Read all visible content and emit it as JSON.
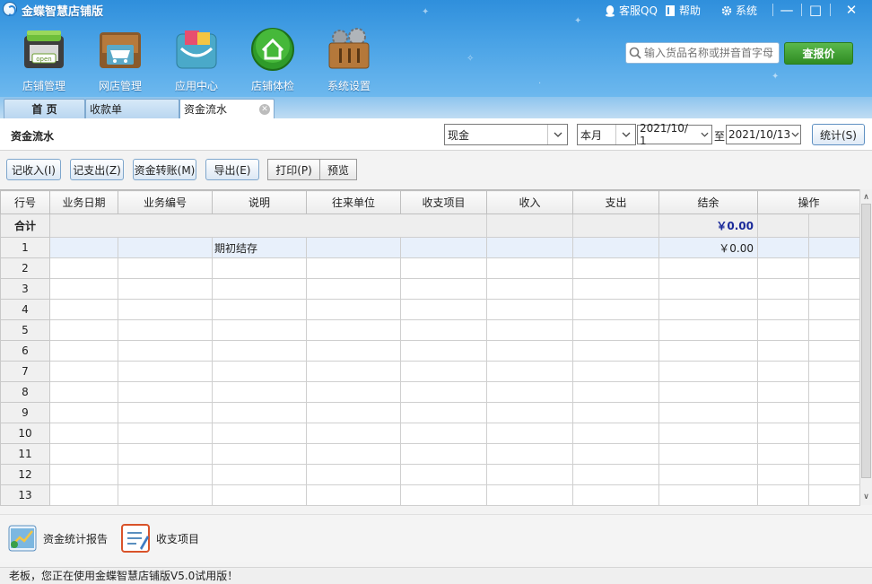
{
  "app": {
    "title": "金蝶智慧店铺版"
  },
  "top_menu": {
    "qq": "客服QQ",
    "help": "帮助",
    "system": "系统"
  },
  "window_controls": {
    "minimize": "—",
    "maximize": "□",
    "close": "✕"
  },
  "nav": [
    {
      "label": "店铺管理",
      "icon": "store-icon"
    },
    {
      "label": "网店管理",
      "icon": "online-shop-cart-icon"
    },
    {
      "label": "应用中心",
      "icon": "app-center-icon"
    },
    {
      "label": "店铺体检",
      "icon": "home-check-icon"
    },
    {
      "label": "系统设置",
      "icon": "settings-toolbox-icon"
    }
  ],
  "search": {
    "placeholder": "输入货品名称或拼音首字母",
    "button": "查报价"
  },
  "tabs": [
    {
      "label": "首 页"
    },
    {
      "label": "收款单"
    },
    {
      "label": "资金流水",
      "active": true
    }
  ],
  "panel": {
    "title": "资金流水",
    "account": "现金",
    "period": "本月",
    "date_from": "2021/10/ 1",
    "to_label": "至",
    "date_to": "2021/10/13",
    "stat_button": "统计(S)"
  },
  "toolbar": {
    "record_income": "记收入(I)",
    "record_expense": "记支出(Z)",
    "transfer": "资金转账(M)",
    "export": "导出(E)",
    "print": "打印(P)",
    "preview": "预览"
  },
  "table": {
    "columns": [
      "行号",
      "业务日期",
      "业务编号",
      "说明",
      "往来单位",
      "收支项目",
      "收入",
      "支出",
      "结余",
      "操作"
    ],
    "total_row": {
      "label": "合计",
      "balance": "￥0.00"
    },
    "rows": [
      {
        "no": "1",
        "date": "",
        "code": "",
        "desc": "期初结存",
        "partner": "",
        "item": "",
        "income": "",
        "expense": "",
        "balance": "￥0.00"
      },
      {
        "no": "2"
      },
      {
        "no": "3"
      },
      {
        "no": "4"
      },
      {
        "no": "5"
      },
      {
        "no": "6"
      },
      {
        "no": "7"
      },
      {
        "no": "8"
      },
      {
        "no": "9"
      },
      {
        "no": "10"
      },
      {
        "no": "11"
      },
      {
        "no": "12"
      },
      {
        "no": "13"
      }
    ]
  },
  "shortcuts": [
    {
      "label": "资金统计报告",
      "icon": "fund-report-icon"
    },
    {
      "label": "收支项目",
      "icon": "income-expense-items-icon"
    }
  ],
  "status": {
    "text": "老板，您正在使用金蝶智慧店铺版V5.0试用版！"
  },
  "colors": {
    "header_top": "#2f8fdc",
    "header_bottom": "#6db8ee",
    "accent_green": "#2f8c22",
    "money_blue": "#1a2a9a"
  }
}
